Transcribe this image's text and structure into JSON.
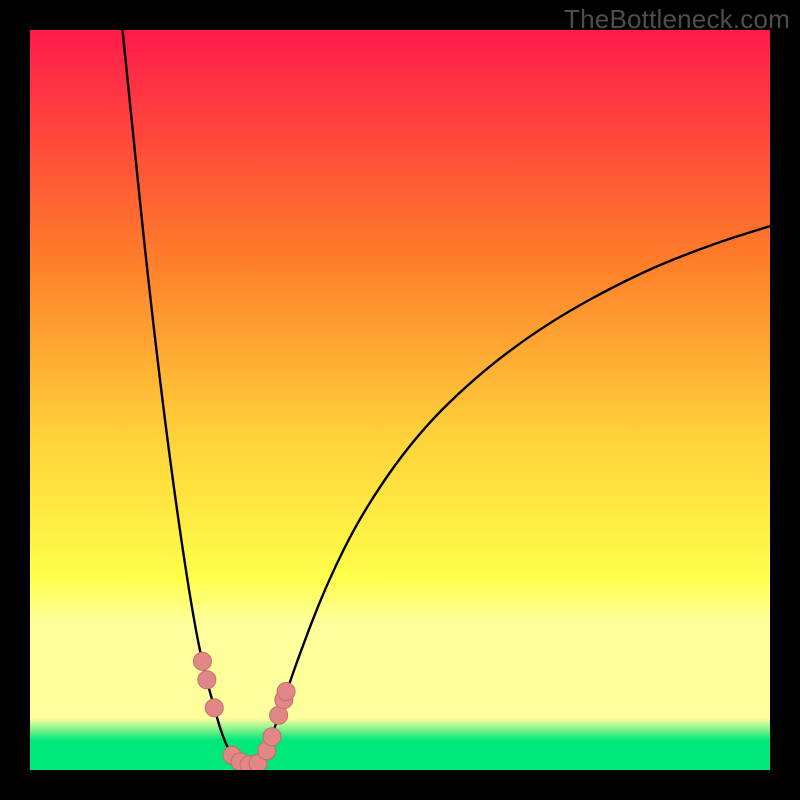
{
  "watermark": "TheBottleneck.com",
  "gradient": {
    "top": "#ff1a4b",
    "upper_mid": "#ff7a2a",
    "mid": "#ffd23a",
    "lower_mid": "#ffff4a",
    "pale_band": "#ffff9c",
    "bottom": "#00e77a"
  },
  "curve": {
    "stroke": "#000000",
    "stroke_width": 2.4
  },
  "markers": {
    "fill": "#e18787",
    "stroke": "#c76b6b",
    "radius": 9
  },
  "chart_data": {
    "type": "line",
    "title": "",
    "xlabel": "",
    "ylabel": "",
    "xlim": [
      0,
      100
    ],
    "ylim": [
      0,
      100
    ],
    "grid": false,
    "legend": false,
    "notes": "V-shaped bottleneck curve; minimum near x≈29. Axes unlabeled in source image — x/y expressed as 0–100% of plot area.",
    "series": [
      {
        "name": "curve-left",
        "x": [
          12.5,
          14,
          16,
          18,
          20,
          22,
          23.5,
          24.6,
          26,
          27.5,
          29
        ],
        "y": [
          100,
          85,
          66,
          49,
          34,
          21,
          13.5,
          9.5,
          4.5,
          1.5,
          0.5
        ]
      },
      {
        "name": "curve-right",
        "x": [
          29,
          31,
          32.3,
          34,
          36,
          40,
          45,
          52,
          60,
          70,
          82,
          92,
          100
        ],
        "y": [
          0.5,
          1.2,
          3.5,
          8.5,
          14.5,
          25,
          35,
          45,
          53,
          60.5,
          67,
          71,
          73.5
        ]
      }
    ],
    "markers_left": [
      {
        "x": 23.3,
        "y": 14.7
      },
      {
        "x": 23.9,
        "y": 12.2
      },
      {
        "x": 24.9,
        "y": 8.4
      },
      {
        "x": 27.3,
        "y": 2.0
      },
      {
        "x": 28.4,
        "y": 1.1
      }
    ],
    "markers_right": [
      {
        "x": 32.0,
        "y": 2.6
      },
      {
        "x": 32.7,
        "y": 4.5
      },
      {
        "x": 33.6,
        "y": 7.4
      },
      {
        "x": 34.3,
        "y": 9.5
      },
      {
        "x": 34.6,
        "y": 10.6
      }
    ],
    "markers_bottom": [
      {
        "x": 29.6,
        "y": 0.7
      },
      {
        "x": 30.8,
        "y": 0.9
      }
    ]
  }
}
